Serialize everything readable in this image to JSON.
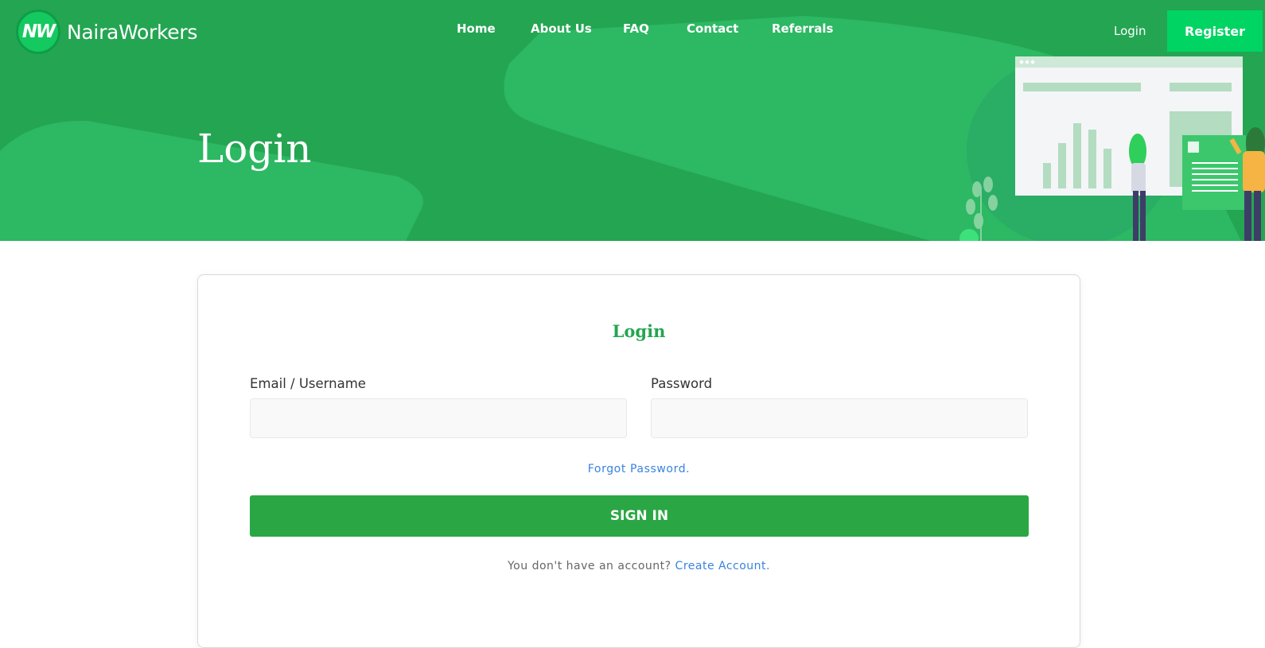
{
  "brand": {
    "logo_mark": "NW",
    "name": "NairaWorkers"
  },
  "nav": {
    "items": [
      "Home",
      "About Us",
      "FAQ",
      "Contact",
      "Referrals"
    ],
    "login_label": "Login",
    "register_label": "Register"
  },
  "hero": {
    "title": "Login"
  },
  "form": {
    "title": "Login",
    "email_label": "Email / Username",
    "email_value": "",
    "password_label": "Password",
    "password_value": "",
    "forgot_label": "Forgot Password.",
    "signin_label": "SIGN IN",
    "account_prompt": "You don't have an account?",
    "create_account_label": "Create Account",
    "create_account_suffix": "."
  },
  "colors": {
    "hero_green": "#24a552",
    "register_green": "#00d463",
    "signin_green": "#2aa744",
    "link_blue": "#3a82e0",
    "title_green": "#24a552"
  }
}
